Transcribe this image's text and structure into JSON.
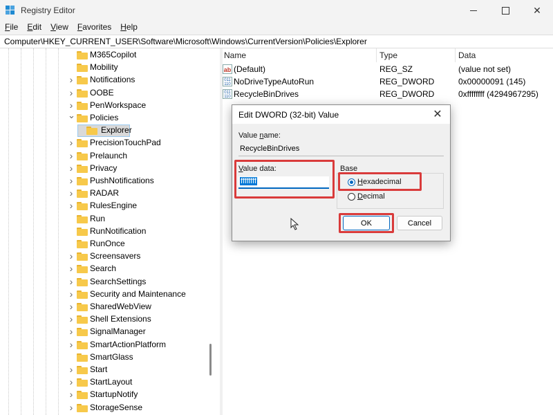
{
  "window": {
    "title": "Registry Editor"
  },
  "menu": [
    "File",
    "Edit",
    "View",
    "Favorites",
    "Help"
  ],
  "address": "Computer\\HKEY_CURRENT_USER\\Software\\Microsoft\\Windows\\CurrentVersion\\Policies\\Explorer",
  "tree": [
    {
      "label": "M365Copilot",
      "expander": ""
    },
    {
      "label": "Mobility",
      "expander": ""
    },
    {
      "label": "Notifications",
      "expander": ">"
    },
    {
      "label": "OOBE",
      "expander": ">"
    },
    {
      "label": "PenWorkspace",
      "expander": ">"
    },
    {
      "label": "Policies",
      "expander": "v"
    },
    {
      "label": "Explorer",
      "expander": "",
      "selected": true
    },
    {
      "label": "PrecisionTouchPad",
      "expander": ">"
    },
    {
      "label": "Prelaunch",
      "expander": ">"
    },
    {
      "label": "Privacy",
      "expander": ">"
    },
    {
      "label": "PushNotifications",
      "expander": ">"
    },
    {
      "label": "RADAR",
      "expander": ">"
    },
    {
      "label": "RulesEngine",
      "expander": ">"
    },
    {
      "label": "Run",
      "expander": ""
    },
    {
      "label": "RunNotification",
      "expander": ""
    },
    {
      "label": "RunOnce",
      "expander": ""
    },
    {
      "label": "Screensavers",
      "expander": ">"
    },
    {
      "label": "Search",
      "expander": ">"
    },
    {
      "label": "SearchSettings",
      "expander": ">"
    },
    {
      "label": "Security and Maintenance",
      "expander": ">"
    },
    {
      "label": "SharedWebView",
      "expander": ">"
    },
    {
      "label": "Shell Extensions",
      "expander": ">"
    },
    {
      "label": "SignalManager",
      "expander": ">"
    },
    {
      "label": "SmartActionPlatform",
      "expander": ">"
    },
    {
      "label": "SmartGlass",
      "expander": ""
    },
    {
      "label": "Start",
      "expander": ">"
    },
    {
      "label": "StartLayout",
      "expander": ">"
    },
    {
      "label": "StartupNotify",
      "expander": ">"
    },
    {
      "label": "StorageSense",
      "expander": ">"
    }
  ],
  "list": {
    "columns": [
      "Name",
      "Type",
      "Data"
    ],
    "rows": [
      {
        "icon": "string-value-icon",
        "name": "(Default)",
        "type": "REG_SZ",
        "data": "(value not set)"
      },
      {
        "icon": "dword-value-icon",
        "name": "NoDriveTypeAutoRun",
        "type": "REG_DWORD",
        "data": "0x00000091 (145)"
      },
      {
        "icon": "dword-value-icon",
        "name": "RecycleBinDrives",
        "type": "REG_DWORD",
        "data": "0xffffffff (4294967295)"
      }
    ]
  },
  "dialog": {
    "title": "Edit DWORD (32-bit) Value",
    "value_name_label": "Value name:",
    "value_name": "RecycleBinDrives",
    "value_data_label": "Value data:",
    "value_data": "ffffffff",
    "base_label": "Base",
    "hex_label": "Hexadecimal",
    "dec_label": "Decimal",
    "base_selected": "Hexadecimal",
    "ok_label": "OK",
    "cancel_label": "Cancel"
  },
  "colors": {
    "highlight_box": "#d93b3b",
    "accent": "#0067c0",
    "folder": "#f7c94b"
  }
}
